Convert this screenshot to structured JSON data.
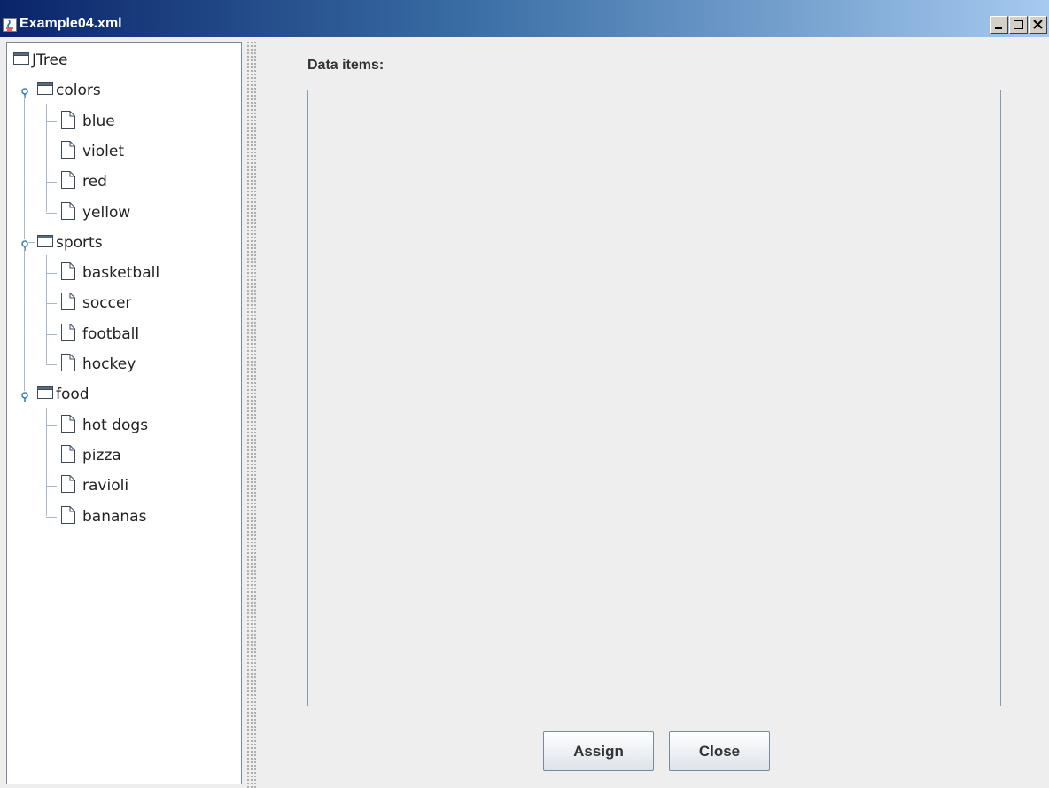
{
  "window": {
    "title": "Example04.xml"
  },
  "tree": {
    "root": "JTree",
    "groups": [
      {
        "label": "colors",
        "items": [
          "blue",
          "violet",
          "red",
          "yellow"
        ]
      },
      {
        "label": "sports",
        "items": [
          "basketball",
          "soccer",
          "football",
          "hockey"
        ]
      },
      {
        "label": "food",
        "items": [
          "hot dogs",
          "pizza",
          "ravioli",
          "bananas"
        ]
      }
    ]
  },
  "main": {
    "data_items_label": "Data items:",
    "assign_label": "Assign",
    "close_label": "Close"
  }
}
